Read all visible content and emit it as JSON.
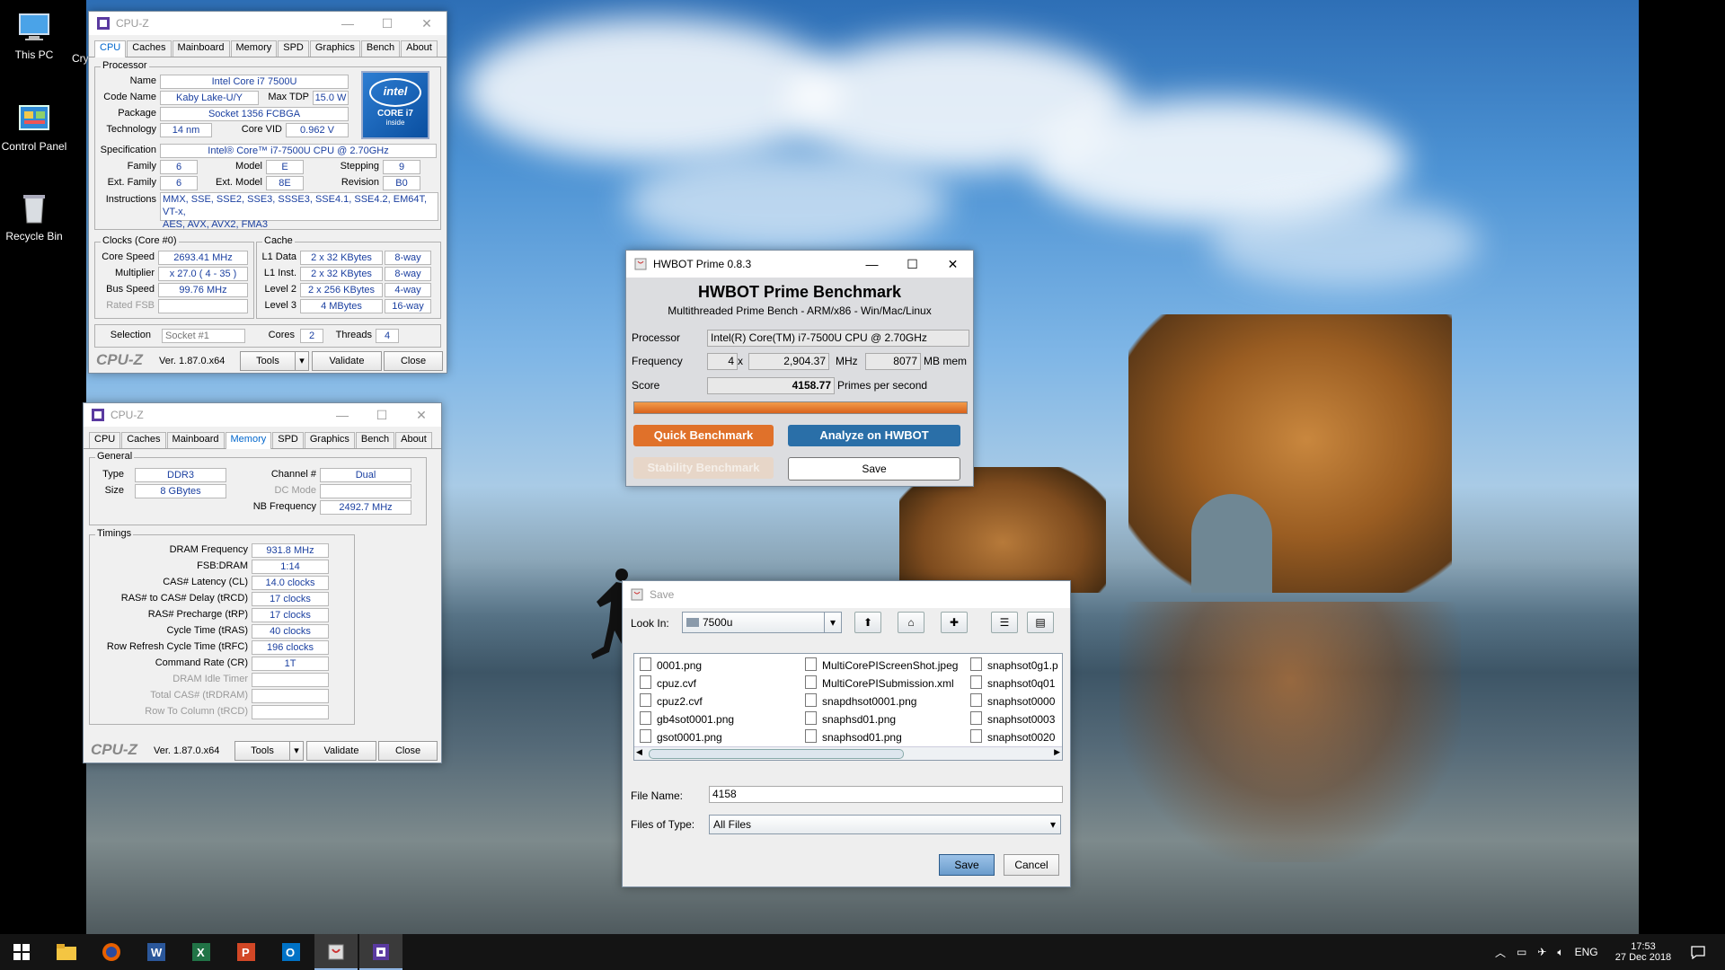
{
  "desktop": {
    "icons": [
      {
        "label": "This PC"
      },
      {
        "label": "Control Panel"
      },
      {
        "label": "Recycle Bin"
      }
    ],
    "partial_icon_label": "Cry"
  },
  "cpuz_cpu": {
    "title": "CPU-Z",
    "tabs": [
      "CPU",
      "Caches",
      "Mainboard",
      "Memory",
      "SPD",
      "Graphics",
      "Bench",
      "About"
    ],
    "selected_tab": "CPU",
    "processor": {
      "group": "Processor",
      "name_label": "Name",
      "name": "Intel Core i7 7500U",
      "codename_label": "Code Name",
      "codename": "Kaby Lake-U/Y",
      "maxtdp_label": "Max TDP",
      "maxtdp": "15.0 W",
      "package_label": "Package",
      "package": "Socket 1356 FCBGA",
      "technology_label": "Technology",
      "technology": "14 nm",
      "corevid_label": "Core VID",
      "corevid": "0.962 V",
      "spec_label": "Specification",
      "spec": "Intel® Core™ i7-7500U CPU @ 2.70GHz",
      "family_label": "Family",
      "family": "6",
      "model_label": "Model",
      "model": "E",
      "stepping_label": "Stepping",
      "stepping": "9",
      "extfamily_label": "Ext. Family",
      "extfamily": "6",
      "extmodel_label": "Ext. Model",
      "extmodel": "8E",
      "revision_label": "Revision",
      "revision": "B0",
      "instructions_label": "Instructions",
      "instructions_line1": "MMX, SSE, SSE2, SSE3, SSSE3, SSE4.1, SSE4.2, EM64T, VT-x,",
      "instructions_line2": "AES, AVX, AVX2, FMA3",
      "logo_brand": "intel",
      "logo_line1": "CORE i7",
      "logo_line2": "inside"
    },
    "clocks": {
      "group": "Clocks (Core #0)",
      "corespeed_label": "Core Speed",
      "corespeed": "2693.41 MHz",
      "multiplier_label": "Multiplier",
      "multiplier": "x 27.0 ( 4 - 35 )",
      "busspeed_label": "Bus Speed",
      "busspeed": "99.76 MHz",
      "ratedfsb_label": "Rated FSB",
      "ratedfsb": ""
    },
    "cache": {
      "group": "Cache",
      "rows": [
        {
          "label": "L1 Data",
          "size": "2 x 32 KBytes",
          "way": "8-way"
        },
        {
          "label": "L1 Inst.",
          "size": "2 x 32 KBytes",
          "way": "8-way"
        },
        {
          "label": "Level 2",
          "size": "2 x 256 KBytes",
          "way": "4-way"
        },
        {
          "label": "Level 3",
          "size": "4 MBytes",
          "way": "16-way"
        }
      ]
    },
    "selection_label": "Selection",
    "selection": "Socket #1",
    "cores_label": "Cores",
    "cores": "2",
    "threads_label": "Threads",
    "threads": "4",
    "logo_text": "CPU-Z",
    "version": "Ver. 1.87.0.x64",
    "tools": "Tools",
    "validate": "Validate",
    "close": "Close"
  },
  "cpuz_mem": {
    "title": "CPU-Z",
    "tabs": [
      "CPU",
      "Caches",
      "Mainboard",
      "Memory",
      "SPD",
      "Graphics",
      "Bench",
      "About"
    ],
    "selected_tab": "Memory",
    "general": {
      "group": "General",
      "type_label": "Type",
      "type": "DDR3",
      "size_label": "Size",
      "size": "8 GBytes",
      "channel_label": "Channel #",
      "channel": "Dual",
      "dcmode_label": "DC Mode",
      "dcmode": "",
      "nbfreq_label": "NB Frequency",
      "nbfreq": "2492.7 MHz"
    },
    "timings": {
      "group": "Timings",
      "rows": [
        {
          "label": "DRAM Frequency",
          "value": "931.8 MHz",
          "gray": false
        },
        {
          "label": "FSB:DRAM",
          "value": "1:14",
          "gray": false
        },
        {
          "label": "CAS# Latency (CL)",
          "value": "14.0 clocks",
          "gray": false
        },
        {
          "label": "RAS# to CAS# Delay (tRCD)",
          "value": "17 clocks",
          "gray": false
        },
        {
          "label": "RAS# Precharge (tRP)",
          "value": "17 clocks",
          "gray": false
        },
        {
          "label": "Cycle Time (tRAS)",
          "value": "40 clocks",
          "gray": false
        },
        {
          "label": "Row Refresh Cycle Time (tRFC)",
          "value": "196 clocks",
          "gray": false
        },
        {
          "label": "Command Rate (CR)",
          "value": "1T",
          "gray": false
        },
        {
          "label": "DRAM Idle Timer",
          "value": "",
          "gray": true
        },
        {
          "label": "Total CAS# (tRDRAM)",
          "value": "",
          "gray": true
        },
        {
          "label": "Row To Column (tRCD)",
          "value": "",
          "gray": true
        }
      ]
    },
    "logo_text": "CPU-Z",
    "version": "Ver. 1.87.0.x64",
    "tools": "Tools",
    "validate": "Validate",
    "close": "Close"
  },
  "hwbot": {
    "title": "HWBOT Prime 0.8.3",
    "heading": "HWBOT Prime Benchmark",
    "subheading": "Multithreaded Prime Bench - ARM/x86 - Win/Mac/Linux",
    "processor_label": "Processor",
    "processor": "Intel(R) Core(TM) i7-7500U CPU @ 2.70GHz",
    "frequency_label": "Frequency",
    "threads": "4",
    "times": "x",
    "mhz_value": "2,904.37",
    "mhz_unit": "MHz",
    "mem_value": "8077",
    "mem_unit": "MB mem",
    "score_label": "Score",
    "score": "4158.77",
    "score_unit": "Primes per second",
    "progress": 1.0,
    "quick_benchmark": "Quick Benchmark",
    "analyze": "Analyze on HWBOT",
    "stability": "Stability Benchmark",
    "save": "Save",
    "colors": {
      "orange": "#e0712a",
      "blue": "#2a6fa8"
    }
  },
  "save_dialog": {
    "title": "Save",
    "lookin_label": "Look In:",
    "lookin_value": "7500u",
    "files": [
      [
        "0001.png",
        "cpuz.cvf",
        "cpuz2.cvf",
        "gb4sot0001.png",
        "gsot0001.png"
      ],
      [
        "MultiCorePIScreenShot.jpeg",
        "MultiCorePISubmission.xml",
        "snapdhsot0001.png",
        "snaphsd01.png",
        "snaphsod01.png"
      ],
      [
        "snaphsot0g1.p",
        "snaphsot0q01",
        "snaphsot0000",
        "snaphsot0003",
        "snaphsot0020"
      ]
    ],
    "filename_label": "File Name:",
    "filename": "4158",
    "filetype_label": "Files of Type:",
    "filetype": "All Files",
    "save": "Save",
    "cancel": "Cancel"
  },
  "taskbar": {
    "apps": [
      "start-icon",
      "file-explorer-icon",
      "firefox-icon",
      "word-icon",
      "excel-icon",
      "powerpoint-icon",
      "outlook-icon",
      "java-app-icon",
      "cpuz-app-icon"
    ],
    "language": "ENG",
    "time": "17:53",
    "date": "27 Dec 2018"
  }
}
